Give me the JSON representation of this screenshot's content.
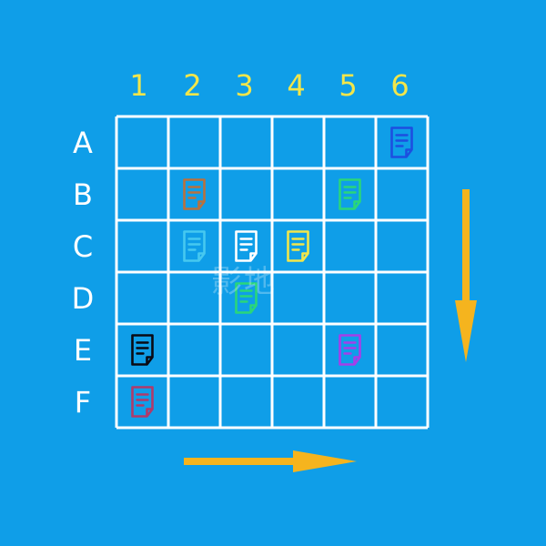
{
  "board": {
    "columns": [
      "1",
      "2",
      "3",
      "4",
      "5",
      "6"
    ],
    "rows": [
      "A",
      "B",
      "C",
      "D",
      "E",
      "F"
    ],
    "grid_color": "#ffffff",
    "background_color": "#0f9ee8",
    "column_label_color": "#f2e64a",
    "row_label_color": "#ffffff",
    "pieces": [
      {
        "row": "A",
        "col": "6",
        "color": "#1d4fe0",
        "icon": "document-icon"
      },
      {
        "row": "B",
        "col": "2",
        "color": "#b8713e",
        "icon": "document-icon"
      },
      {
        "row": "B",
        "col": "5",
        "color": "#2ad67a",
        "icon": "document-icon"
      },
      {
        "row": "C",
        "col": "2",
        "color": "#46c8f0",
        "icon": "document-icon"
      },
      {
        "row": "C",
        "col": "3",
        "color": "#ffffff",
        "icon": "document-icon"
      },
      {
        "row": "C",
        "col": "4",
        "color": "#f2e64a",
        "icon": "document-icon"
      },
      {
        "row": "D",
        "col": "3",
        "color": "#2ad67a",
        "icon": "document-icon"
      },
      {
        "row": "E",
        "col": "1",
        "color": "#0a0a14",
        "icon": "document-icon"
      },
      {
        "row": "E",
        "col": "5",
        "color": "#a63ee8",
        "icon": "document-icon"
      },
      {
        "row": "F",
        "col": "1",
        "color": "#b03a6a",
        "icon": "document-icon"
      }
    ]
  },
  "arrows": {
    "down": {
      "icon": "arrow-down-icon",
      "color": "#f5b41e"
    },
    "right": {
      "icon": "arrow-right-icon",
      "color": "#f5b41e"
    }
  },
  "watermark": {
    "text": "影地"
  }
}
